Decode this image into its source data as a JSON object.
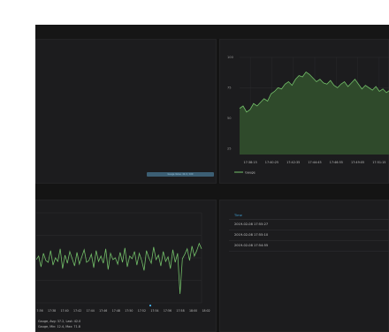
{
  "dashboard": {
    "panel2": {
      "y_ticks": [
        "100",
        "75",
        "50",
        "25"
      ],
      "x_ticks": [
        "17:38:15",
        "17:40:25",
        "17:42:35",
        "17:44:45",
        "17:46:55",
        "17:49:05",
        "17:51:15"
      ],
      "legend": "Gauge",
      "series_color": "#73bf69",
      "fill_color": "#2f4a2b"
    },
    "panel1": {
      "legend_pill": "Gauge Value: 42.0 / 100"
    },
    "panel3": {
      "x_ticks": [
        "17:36",
        "17:38",
        "17:40",
        "17:42",
        "17:44",
        "17:46",
        "17:48",
        "17:50",
        "17:52",
        "17:54",
        "17:56",
        "17:58",
        "18:00",
        "18:02"
      ],
      "legend_line1": "Gauge, Avg: 37.2, Last: 42.0",
      "legend_line2": "Gauge, Min: 12.4, Max: 71.8",
      "series_color": "#73bf69",
      "marker_color": "#3fa2d8"
    },
    "panel4": {
      "header": "Time",
      "rows": [
        "2019-02-08 17:55:27",
        "2019-02-08 17:55:10",
        "2019-02-08 17:54:55"
      ]
    }
  },
  "chart_data": [
    {
      "type": "area",
      "y_ticks": [
        25,
        50,
        75,
        100
      ],
      "ylim": [
        20,
        100
      ],
      "x": [
        "17:38:15",
        "17:40:25",
        "17:42:35",
        "17:44:45",
        "17:46:55",
        "17:49:05",
        "17:51:15"
      ],
      "series": [
        {
          "name": "Gauge",
          "values": [
            58,
            60,
            55,
            57,
            62,
            60,
            63,
            66,
            64,
            70,
            72,
            75,
            74,
            78,
            80,
            77,
            82,
            85,
            84,
            88,
            86,
            83,
            80,
            82,
            79,
            78,
            81,
            77,
            75,
            78,
            80,
            76,
            79,
            82,
            78,
            74,
            77,
            75,
            73,
            76,
            72,
            74,
            71,
            73
          ]
        }
      ]
    },
    {
      "type": "line",
      "ylim": [
        0,
        100
      ],
      "x": [
        "17:36",
        "17:38",
        "17:40",
        "17:42",
        "17:44",
        "17:46",
        "17:48",
        "17:50",
        "17:52",
        "17:54",
        "17:56",
        "17:58",
        "18:00",
        "18:02"
      ],
      "series": [
        {
          "name": "Gauge",
          "values": [
            48,
            52,
            40,
            55,
            47,
            45,
            58,
            42,
            50,
            46,
            60,
            38,
            53,
            44,
            57,
            49,
            41,
            56,
            43,
            51,
            59,
            45,
            47,
            54,
            39,
            58,
            46,
            52,
            44,
            60,
            37,
            55,
            48,
            50,
            43,
            56,
            45,
            61,
            40,
            52,
            49,
            57,
            42,
            55,
            47,
            36,
            58,
            50,
            44,
            62,
            48,
            53,
            41,
            57,
            46,
            51,
            38,
            59,
            45,
            55,
            10,
            49,
            54,
            60,
            47,
            63,
            52,
            58,
            66,
            60
          ]
        }
      ]
    }
  ]
}
